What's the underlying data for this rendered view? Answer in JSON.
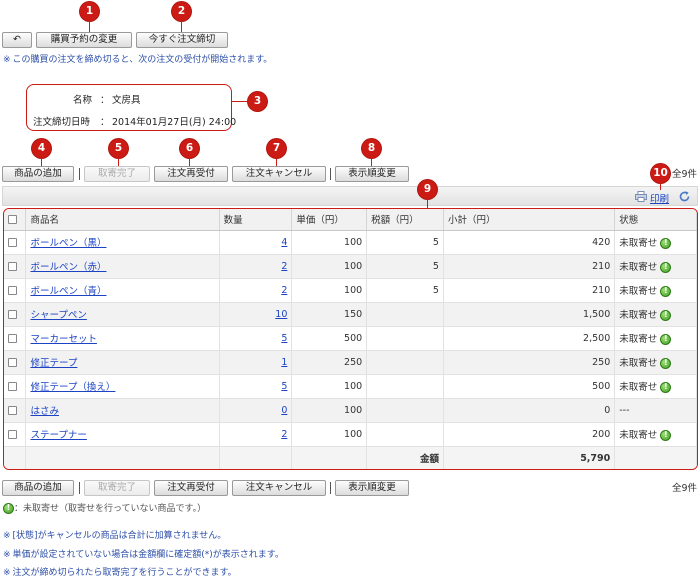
{
  "top": {
    "back_label": "↶",
    "change_label": "購買予約の変更",
    "close_label": "今すぐ注文締切",
    "notice": "この購買の注文を締め切ると、次の注文の受付が開始されます。"
  },
  "info": {
    "name_label": "名称",
    "name_value": "文房具",
    "deadline_label": "注文締切日時",
    "deadline_value": "2014年01月27日(月) 24:00",
    "colon": "："
  },
  "actions": {
    "add": "商品の追加",
    "done": "取寄完了",
    "reaccept": "注文再受付",
    "cancel": "注文キャンセル",
    "reorder": "表示順変更"
  },
  "count_label": "全9件",
  "print_label": "印刷",
  "table": {
    "headers": [
      "商品名",
      "数量",
      "単価（円）",
      "税額（円）",
      "小計（円）",
      "状態"
    ],
    "rows": [
      {
        "name": "ボールペン（黒）",
        "qty": "4",
        "price": "100",
        "tax": "5",
        "subtotal": "420",
        "status": "未取寄せ",
        "icon": true
      },
      {
        "name": "ボールペン（赤）",
        "qty": "2",
        "price": "100",
        "tax": "5",
        "subtotal": "210",
        "status": "未取寄せ",
        "icon": true
      },
      {
        "name": "ボールペン（青）",
        "qty": "2",
        "price": "100",
        "tax": "5",
        "subtotal": "210",
        "status": "未取寄せ",
        "icon": true
      },
      {
        "name": "シャープペン",
        "qty": "10",
        "price": "150",
        "tax": "",
        "subtotal": "1,500",
        "status": "未取寄せ",
        "icon": true
      },
      {
        "name": "マーカーセット",
        "qty": "5",
        "price": "500",
        "tax": "",
        "subtotal": "2,500",
        "status": "未取寄せ",
        "icon": true
      },
      {
        "name": "修正テープ",
        "qty": "1",
        "price": "250",
        "tax": "",
        "subtotal": "250",
        "status": "未取寄せ",
        "icon": true
      },
      {
        "name": "修正テープ（換え）",
        "qty": "5",
        "price": "100",
        "tax": "",
        "subtotal": "500",
        "status": "未取寄せ",
        "icon": true
      },
      {
        "name": "はさみ",
        "qty": "0",
        "price": "100",
        "tax": "",
        "subtotal": "0",
        "status": "---",
        "icon": false
      },
      {
        "name": "ステープナー",
        "qty": "2",
        "price": "100",
        "tax": "",
        "subtotal": "200",
        "status": "未取寄せ",
        "icon": true
      }
    ],
    "total_label": "金額",
    "total_value": "5,790"
  },
  "legend": "：未取寄せ（取寄せを行っていない商品です。）",
  "footnotes": [
    "[状態]がキャンセルの商品は合計に加算されません。",
    "単価が設定されていない場合は金額欄に確定額(*)が表示されます。",
    "注文が締め切られたら取寄完了を行うことができます。"
  ],
  "markers": [
    "1",
    "2",
    "3",
    "4",
    "5",
    "6",
    "7",
    "8",
    "9",
    "10"
  ],
  "colors": {
    "marker": "#cc1b14",
    "link": "#1c43c4",
    "note": "#2c4fa8",
    "status_icon": "#3e9e1e"
  }
}
